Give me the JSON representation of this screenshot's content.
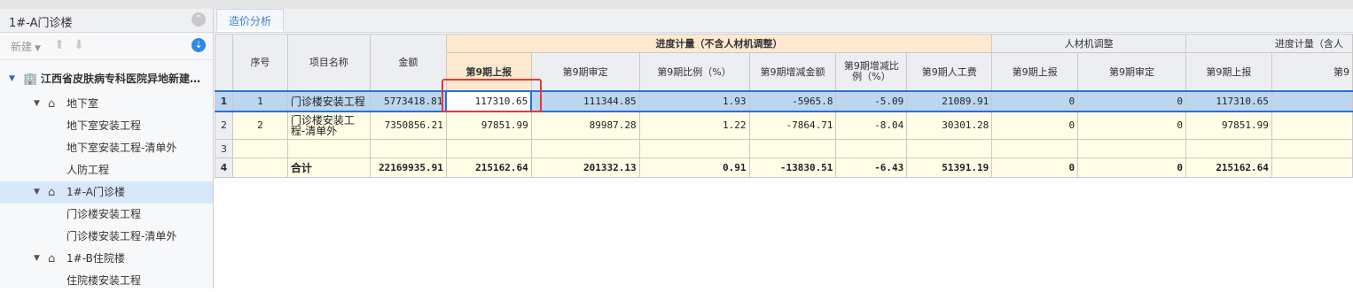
{
  "left_panel": {
    "title": "1#-A门诊楼",
    "new_label": "新建",
    "tree": [
      {
        "label": "江西省皮肤病专科医院异地新建…",
        "level": 0
      },
      {
        "label": "地下室",
        "level": 1
      },
      {
        "label": "地下室安装工程",
        "level": 2
      },
      {
        "label": "地下室安装工程-清单外",
        "level": 2
      },
      {
        "label": "人防工程",
        "level": 2
      },
      {
        "label": "1#-A门诊楼",
        "level": 1,
        "selected": true
      },
      {
        "label": "门诊楼安装工程",
        "level": 2
      },
      {
        "label": "门诊楼安装工程-清单外",
        "level": 2
      },
      {
        "label": "1#-B住院楼",
        "level": 1
      },
      {
        "label": "住院楼安装工程",
        "level": 2
      }
    ]
  },
  "tabs": [
    {
      "label": "造价分析"
    }
  ],
  "table": {
    "group_headers": {
      "progress_excl": "进度计量（不含人材机调整）",
      "rcj_adjust": "人材机调整",
      "progress_incl": "进度计量（含人"
    },
    "headers": {
      "seq": "序号",
      "name": "项目名称",
      "amount": "金额",
      "p9_report": "第9期上报",
      "p9_audit": "第9期审定",
      "p9_ratio": "第9期比例（%）",
      "p9_diff_amt": "第9期增减金额",
      "p9_diff_ratio": "第9期增减比例（%）",
      "p9_labor": "第9期人工费",
      "rcj_report": "第9期上报",
      "rcj_audit": "第9期审定",
      "incl_report": "第9期上报",
      "incl_audit": "第9"
    },
    "rows": [
      {
        "rn": "1",
        "seq": "1",
        "name": "门诊楼安装工程",
        "amount": "5773418.81",
        "p9_report": "117310.65",
        "p9_audit": "111344.85",
        "p9_ratio": "1.93",
        "p9_diff_amt": "-5965.8",
        "p9_diff_ratio": "-5.09",
        "p9_labor": "21089.91",
        "rcj_report": "0",
        "rcj_audit": "0",
        "incl_report": "117310.65",
        "incl_audit": ""
      },
      {
        "rn": "2",
        "seq": "2",
        "name": "门诊楼安装工程-清单外",
        "amount": "7350856.21",
        "p9_report": "97851.99",
        "p9_audit": "89987.28",
        "p9_ratio": "1.22",
        "p9_diff_amt": "-7864.71",
        "p9_diff_ratio": "-8.04",
        "p9_labor": "30301.28",
        "rcj_report": "0",
        "rcj_audit": "0",
        "incl_report": "97851.99",
        "incl_audit": ""
      },
      {
        "rn": "3",
        "seq": "",
        "name": "",
        "amount": "",
        "p9_report": "",
        "p9_audit": "",
        "p9_ratio": "",
        "p9_diff_amt": "",
        "p9_diff_ratio": "",
        "p9_labor": "",
        "rcj_report": "",
        "rcj_audit": "",
        "incl_report": "",
        "incl_audit": ""
      },
      {
        "rn": "4",
        "seq": "",
        "name": "合计",
        "amount": "22169935.91",
        "p9_report": "215162.64",
        "p9_audit": "201332.13",
        "p9_ratio": "0.91",
        "p9_diff_amt": "-13830.51",
        "p9_diff_ratio": "-6.43",
        "p9_labor": "51391.19",
        "rcj_report": "0",
        "rcj_audit": "0",
        "incl_report": "215162.64",
        "incl_audit": ""
      }
    ]
  },
  "colors": {
    "selection": "#bcd6f0",
    "accent": "#2870d8",
    "highlight_box": "#e53935",
    "header_orange": "#fde9cf"
  }
}
